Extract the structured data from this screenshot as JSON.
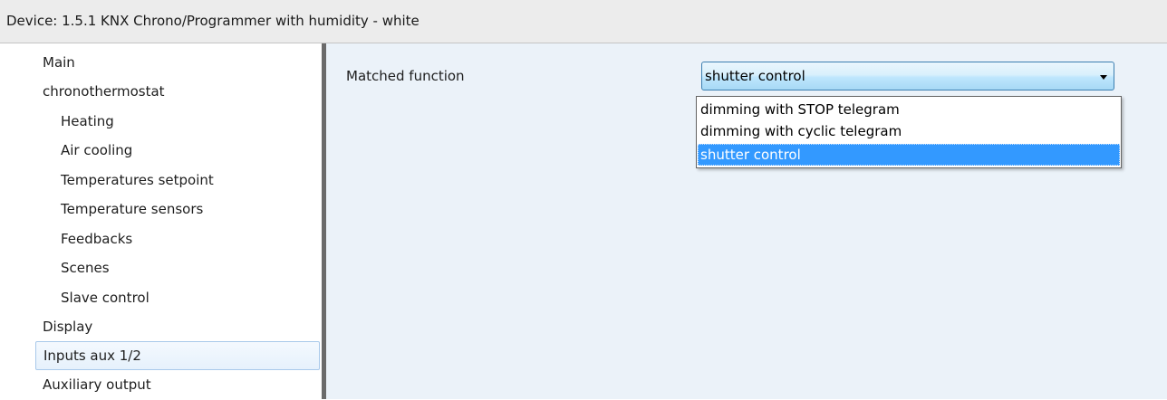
{
  "window": {
    "title": "Device: 1.5.1  KNX Chrono/Programmer with humidity - white"
  },
  "sidebar": {
    "items": [
      {
        "label": "Main"
      },
      {
        "label": "chronothermostat"
      },
      {
        "label": "Heating"
      },
      {
        "label": "Air cooling"
      },
      {
        "label": "Temperatures setpoint"
      },
      {
        "label": "Temperature sensors"
      },
      {
        "label": "Feedbacks"
      },
      {
        "label": "Scenes"
      },
      {
        "label": "Slave control"
      },
      {
        "label": "Display"
      },
      {
        "label": "Inputs aux 1/2",
        "selected": true
      },
      {
        "label": "Auxiliary output"
      }
    ]
  },
  "main": {
    "parameter_label": "Matched function",
    "combo": {
      "value": "shutter control",
      "options": [
        "dimming with STOP telegram",
        "dimming with cyclic telegram",
        "shutter control"
      ],
      "selected_index": 2
    }
  },
  "icons": {
    "combo_arrow": "chevron-down-icon"
  },
  "colors": {
    "selection": "#3399ff",
    "panel_background": "#ebf2f9",
    "combo_border": "#3c7fb1",
    "splitter": "#6b6b6b"
  }
}
